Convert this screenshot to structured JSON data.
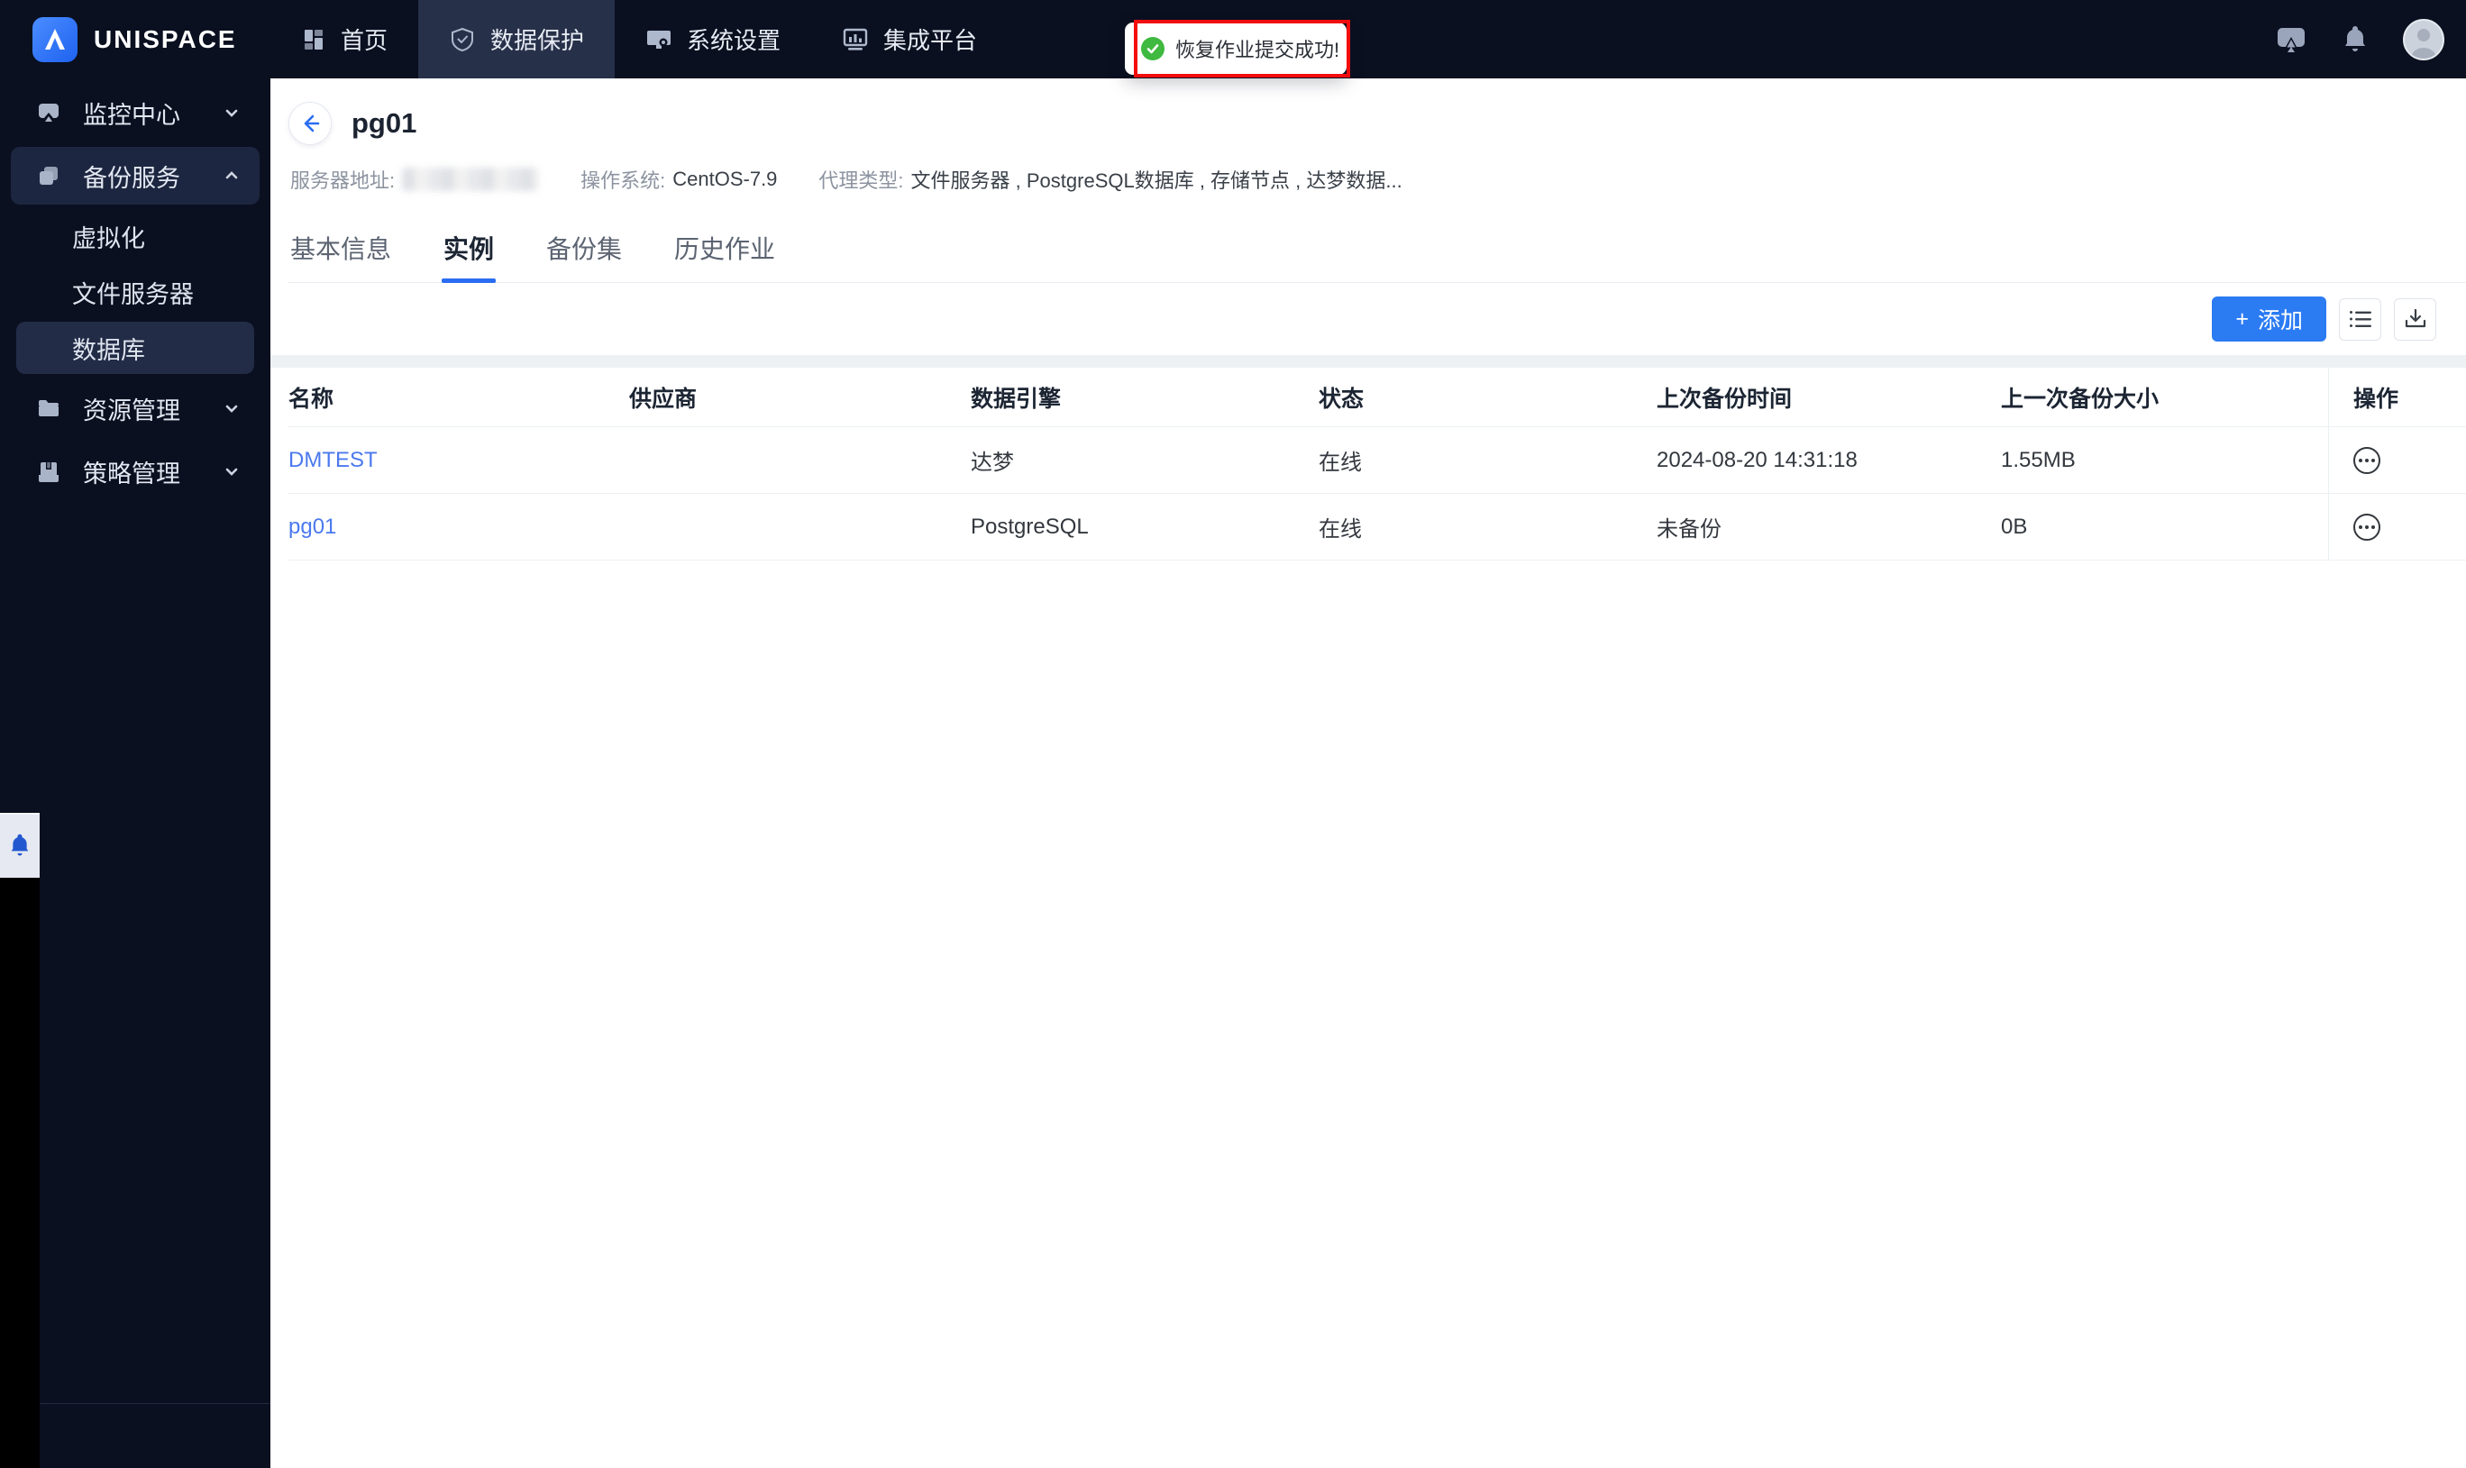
{
  "brand": {
    "name": "UNISPACE"
  },
  "topnav": {
    "items": [
      {
        "label": "首页",
        "icon": "home-grid-icon",
        "active": false
      },
      {
        "label": "数据保护",
        "icon": "shield-check-icon",
        "active": true
      },
      {
        "label": "系统设置",
        "icon": "system-settings-icon",
        "active": false
      },
      {
        "label": "集成平台",
        "icon": "integration-chart-icon",
        "active": false
      }
    ]
  },
  "toast": {
    "message": "恢复作业提交成功!",
    "status": "success"
  },
  "sidebar": {
    "groups": [
      {
        "label": "监控中心",
        "icon": "monitor-icon",
        "state": "collapsed"
      },
      {
        "label": "备份服务",
        "icon": "copy-icon",
        "state": "expanded",
        "children": [
          {
            "label": "虚拟化",
            "selected": false
          },
          {
            "label": "文件服务器",
            "selected": false
          },
          {
            "label": "数据库",
            "selected": true
          }
        ]
      },
      {
        "label": "资源管理",
        "icon": "folder-icon",
        "state": "collapsed"
      },
      {
        "label": "策略管理",
        "icon": "archive-icon",
        "state": "collapsed"
      }
    ]
  },
  "page": {
    "title": "pg01",
    "info": {
      "server_label": "服务器地址:",
      "server_value_redacted": true,
      "os_label": "操作系统:",
      "os_value": "CentOS-7.9",
      "agent_label": "代理类型:",
      "agent_value": "文件服务器 , PostgreSQL数据库 , 存储节点 , 达梦数据..."
    },
    "tabs": [
      {
        "label": "基本信息",
        "active": false
      },
      {
        "label": "实例",
        "active": true
      },
      {
        "label": "备份集",
        "active": false
      },
      {
        "label": "历史作业",
        "active": false
      }
    ],
    "toolbar": {
      "add_label": "添加",
      "add_plus": "+"
    }
  },
  "table": {
    "headers": [
      "名称",
      "供应商",
      "数据引擎",
      "状态",
      "上次备份时间",
      "上一次备份大小",
      "操作"
    ],
    "rows": [
      {
        "name": "DMTEST",
        "vendor": "",
        "engine": "达梦",
        "status": "在线",
        "last_backup_time": "2024-08-20 14:31:18",
        "last_backup_size": "1.55MB"
      },
      {
        "name": "pg01",
        "vendor": "",
        "engine": "PostgreSQL",
        "status": "在线",
        "last_backup_time": "未备份",
        "last_backup_size": "0B"
      }
    ]
  },
  "colors": {
    "topbar_bg": "#0a1020",
    "active_nav_bg": "#273049",
    "accent_blue": "#2b7bf3",
    "link_blue": "#4b79ee",
    "toast_green": "#3fb93f",
    "annotation_red": "#f40d0d"
  }
}
